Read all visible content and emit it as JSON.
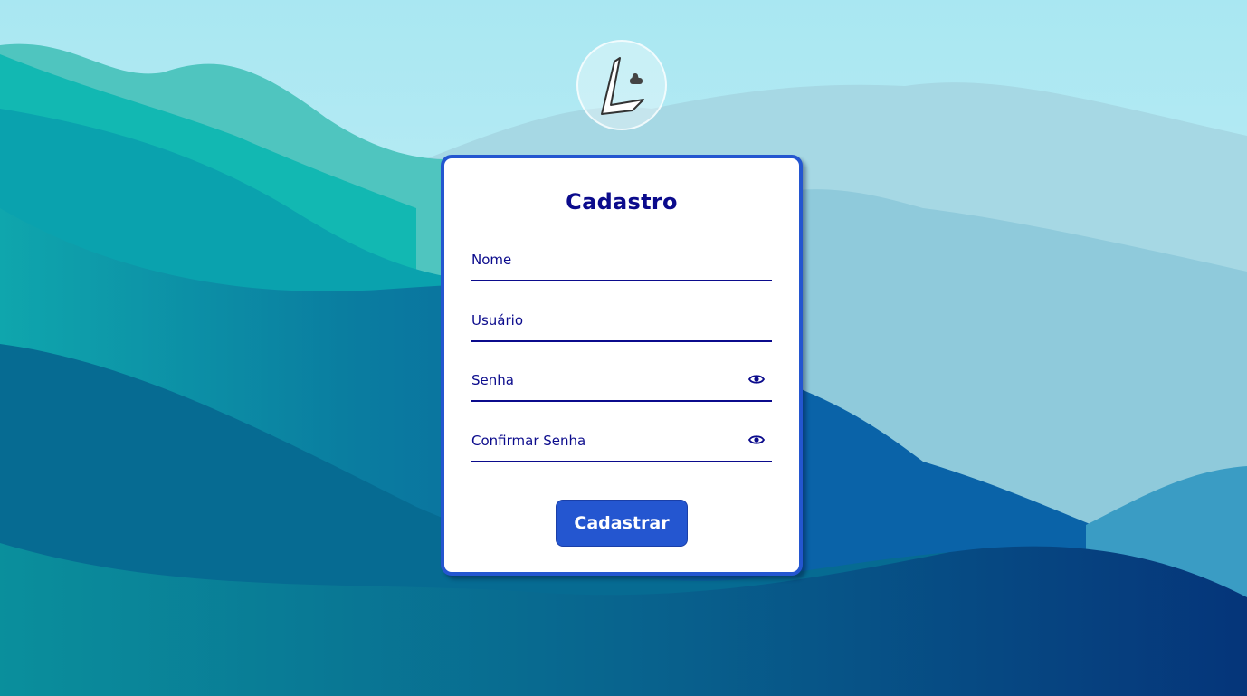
{
  "form": {
    "title": "Cadastro",
    "fields": [
      {
        "label": "Nome"
      },
      {
        "label": "Usuário"
      },
      {
        "label": "Senha",
        "icon": "eye-icon"
      },
      {
        "label": "Confirmar Senha",
        "icon": "eye-icon"
      }
    ],
    "submit_label": "Cadastrar"
  },
  "logo": {
    "icon": "logo-icon"
  },
  "colors": {
    "accent": "#2456d0",
    "text": "#0b0b8c",
    "card": "#ffffff"
  }
}
